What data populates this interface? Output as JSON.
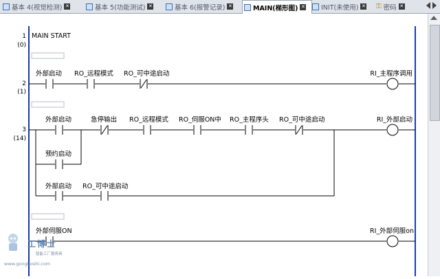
{
  "tabs": [
    {
      "label": "基本 4(视觉检测)"
    },
    {
      "label": "基本 5(功能测试)"
    },
    {
      "label": "基本 6(报警记录)"
    },
    {
      "label": "MAIN(梯形图)"
    },
    {
      "label": "INIT(未使用)"
    },
    {
      "label": "密码"
    }
  ],
  "rungs": [
    {
      "number": "1",
      "step": "(0)",
      "comment": "MAIN START"
    },
    {
      "number": "2",
      "step": "(1)",
      "contacts": [
        "外部启动",
        "RO_远程模式",
        "RO_可中途启动"
      ],
      "coil": "RI_主程序调用"
    },
    {
      "number": "3",
      "step": "(14)",
      "contacts": [
        "外部启动",
        "急停输出",
        "RO_远程模式",
        "RO_伺服ON中",
        "RO_主程序头",
        "RO_可中途启动"
      ],
      "branch1": [
        "预约启动"
      ],
      "branch2": [
        "外部启动",
        "RO_可中途启动"
      ],
      "coil": "RI_外部启动"
    },
    {
      "contacts": [
        "外部伺服ON"
      ],
      "coil": "RI_外部伺服on"
    }
  ],
  "watermark": {
    "name": "工博士",
    "subtitle": "智能工厂服务商",
    "url": "www.gongboshi.com"
  }
}
